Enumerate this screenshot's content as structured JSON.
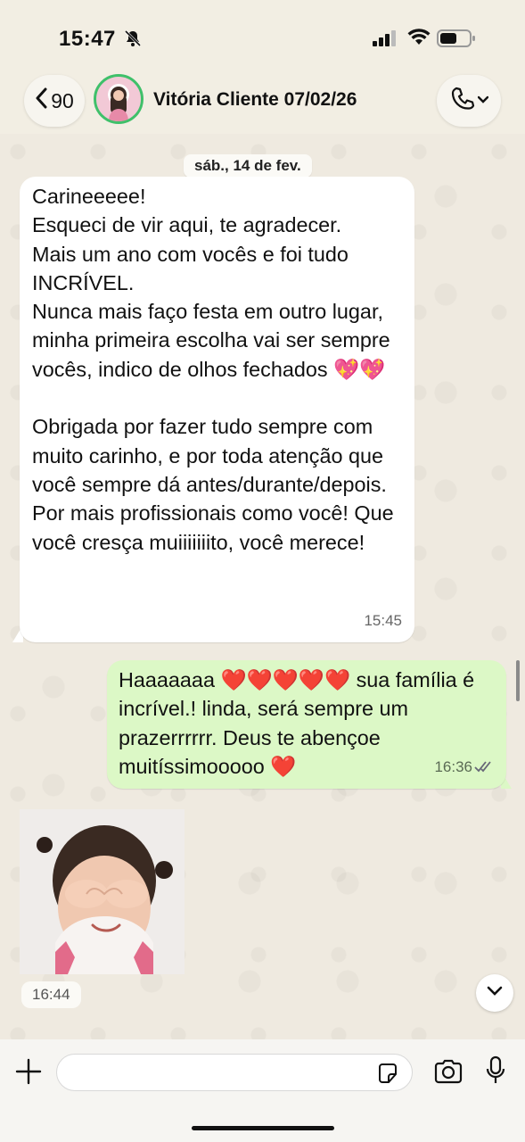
{
  "status_bar": {
    "time": "15:47"
  },
  "header": {
    "back_count": "90",
    "contact_name": "Vitória Cliente 07/02/26"
  },
  "chat": {
    "date_separator": "sáb., 14 de fev.",
    "messages": [
      {
        "direction": "incoming",
        "text": "Carineeeee!\nEsqueci de vir aqui, te agradecer.\nMais um ano com vocês e foi tudo INCRÍVEL.\nNunca mais faço festa em outro lugar, minha primeira escolha vai ser sempre vocês, indico de olhos fechados 💖💖\n\nObrigada por fazer tudo sempre com muito carinho, e por toda atenção que você sempre dá antes/durante/depois. Por mais profissionais como você! Que você cresça muiiiiiiito, você merece!",
        "time": "15:45"
      },
      {
        "direction": "outgoing",
        "text": "Haaaaaaa ❤️❤️❤️❤️❤️ sua família é incrível.! linda, será sempre um prazerrrrrr. Deus te abençoe muitíssimooooo ❤️",
        "time": "16:36",
        "status": "read"
      },
      {
        "direction": "incoming",
        "type": "photo",
        "time": "16:44"
      }
    ]
  },
  "composer": {
    "placeholder": ""
  },
  "icons": [
    "muted-bell-icon",
    "signal-icon",
    "wifi-icon",
    "battery-icon",
    "chevron-left-icon",
    "phone-icon",
    "chevron-down-icon",
    "plus-icon",
    "sticker-icon",
    "camera-icon",
    "microphone-icon",
    "double-check-icon"
  ],
  "colors": {
    "outgoing_bubble": "#dcf8c6",
    "incoming_bubble": "#ffffff",
    "avatar_ring": "#3fc06a"
  }
}
